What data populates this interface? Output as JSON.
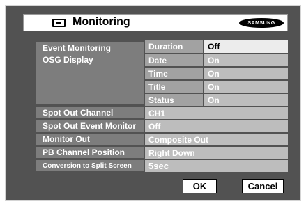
{
  "header": {
    "title": "Monitoring",
    "icon": "monitor-icon",
    "brand": "SAMSUNG"
  },
  "labels": {
    "event_monitoring": "Event Monitoring",
    "osg_display": "OSG Display",
    "spot_out_channel": "Spot Out Channel",
    "spot_out_event_monitor": "Spot Out Event Monitor",
    "monitor_out": "Monitor Out",
    "pb_channel_position": "PB Channel Position",
    "conversion_to_split_screen": "Conversion to Split Screen"
  },
  "sublabels": {
    "duration": "Duration",
    "date": "Date",
    "time": "Time",
    "title": "Title",
    "status": "Status"
  },
  "values": {
    "duration": "Off",
    "date": "On",
    "time": "On",
    "title": "On",
    "status": "On",
    "spot_out_channel": "CH1",
    "spot_out_event_monitor": "Off",
    "monitor_out": "Composite Out",
    "pb_channel_position": "Right Down",
    "conversion_to_split_screen": "5sec"
  },
  "buttons": {
    "ok": "OK",
    "cancel": "Cancel"
  },
  "colors": {
    "panel": "#525252",
    "label_cell": "#7d7d7d",
    "sub_cell": "#a2a2a2",
    "value_cell": "#bdbdbd",
    "selected_cell": "#ececec"
  }
}
